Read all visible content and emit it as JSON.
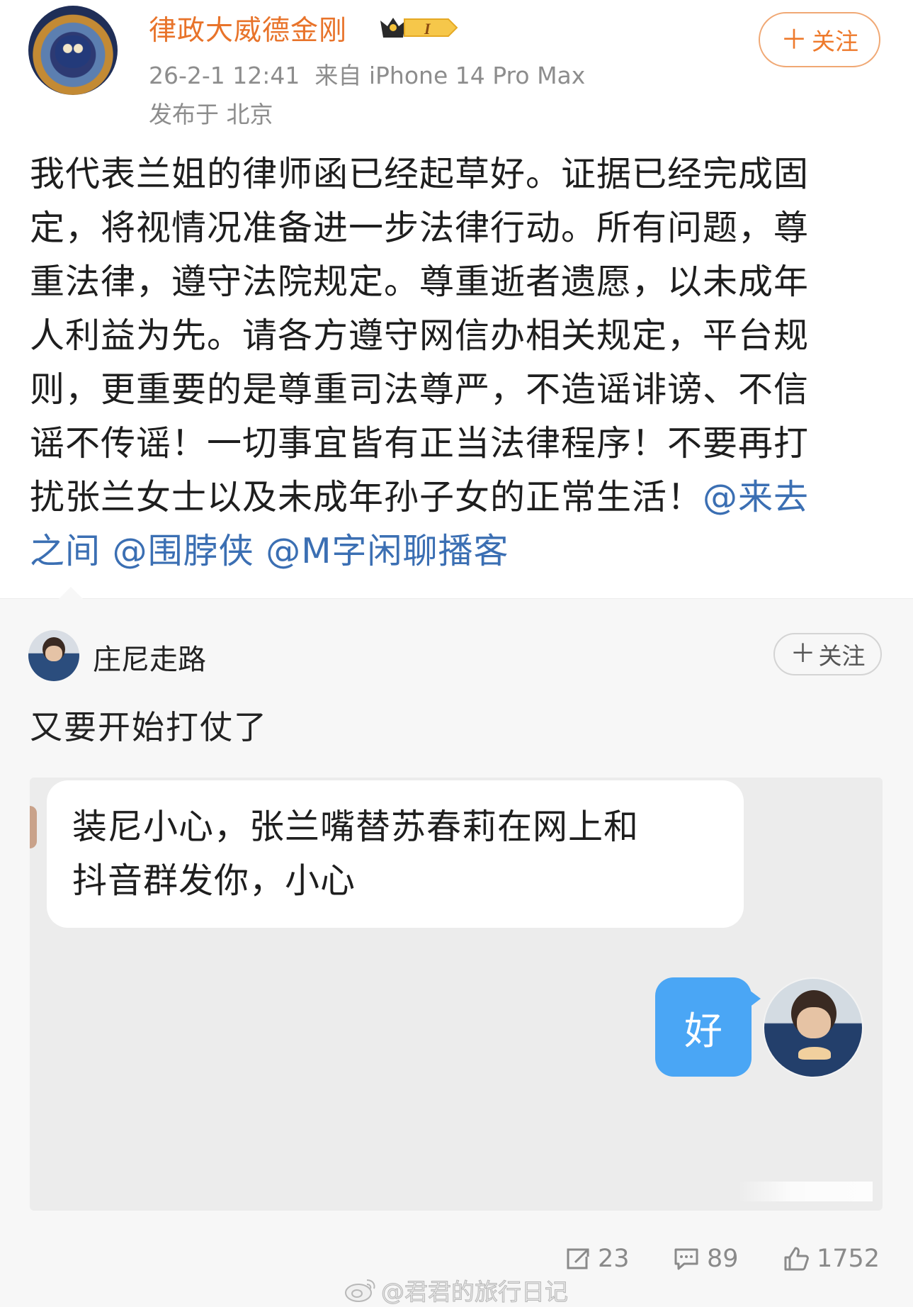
{
  "post": {
    "author": "律政大威德金刚",
    "vip_level": "I",
    "timestamp": "26-2-1 12:41",
    "source": "来自 iPhone 14 Pro Max",
    "location": "发布于 北京",
    "follow_label": "关注",
    "follow_plus": "＋",
    "body_lines": [
      "我代表兰姐的律师函已经起草好。证据已经完成固",
      "定，将视情况准备进一步法律行动。所有问题，尊",
      "重法律，遵守法院规定。尊重逝者遗愿，以未成年",
      "人利益为先。请各方遵守网信办相关规定，平台规",
      "则，更重要的是尊重司法尊严，不造谣诽谤、不信",
      "谣不传谣！一切事宜皆有正当法律程序！不要再打"
    ],
    "body_last_text": "扰张兰女士以及未成年孙子女的正常生活！",
    "mention_1_part1": "@来去",
    "mention_1_part2": "之间",
    "mention_2": "@围脖侠",
    "mention_3": "@M字闲聊播客"
  },
  "retweet": {
    "author": "庄尼走路",
    "follow_label": "关注",
    "follow_plus": "＋",
    "text": "又要开始打仗了"
  },
  "chat": {
    "incoming_line1": "装尼小心，张兰嘴替苏春莉在网上和",
    "incoming_line2": "抖音群发你，小心",
    "outgoing": "好"
  },
  "stats": {
    "reposts": "23",
    "comments": "89",
    "likes": "1752"
  },
  "watermark": "@君君的旅行日记",
  "colors": {
    "author": "#e8732a",
    "mention": "#3b6fb3",
    "chat_bubble_out": "#4aa6f5",
    "meta_gray": "#8d8d8d"
  },
  "icons": [
    "vip-crown-icon",
    "repost-icon",
    "comment-icon",
    "like-icon",
    "weibo-logo-icon"
  ]
}
